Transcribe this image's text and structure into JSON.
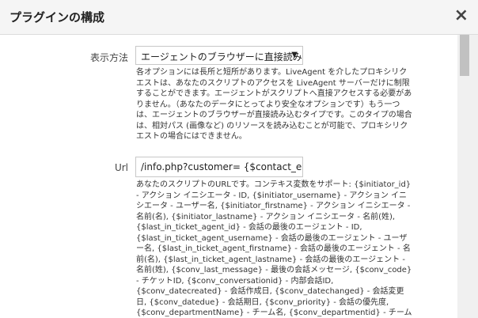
{
  "dialog": {
    "title": "プラグインの構成",
    "close_glyph": "×"
  },
  "fields": {
    "display_method": {
      "label": "表示方法",
      "selected": "エージェントのブラウザーに直接読み込む",
      "help": "各オプションには長所と短所があります。LiveAgent を介したプロキシリクエストは、あなたのスクリプトのアクセスを LiveAgent サーバーだけに制限することができます。エージェントがスクリプトへ直接アクセスする必要がありません。（あなたのデータにとってより安全なオプションです）もう一つは、エージェントのブラウザーが直接読み込むタイプです。このタイプの場合は、相対パス (画像など) のリソースを読み込むことが可能で、プロキシリクエストの場合にはできません。"
    },
    "url": {
      "label": "Url",
      "value": "/info.php?customer= {$contact_email}",
      "help": "あなたのスクリプトのURLです。コンテキス変数をサポート: {$initiator_id} - アクション イニシエータ - ID, {$initiator_username} - アクション イニシエータ - ユーザー名, {$initiator_firstname} - アクション イニシエータ - 名前(名), {$initiator_lastname} - アクション イニシエータ - 名前(姓), {$last_in_ticket_agent_id} - 会話の最後のエージェント - ID, {$last_in_ticket_agent_username} - 会話の最後のエージェント - ユーザー名, {$last_in_ticket_agent_firstname} - 会話の最後のエージェント - 名前(名), {$last_in_ticket_agent_lastname} - 会話の最後のエージェント - 名前(姓), {$conv_last_message} - 最後の会話メッセージ, {$conv_code} - チケットID, {$conv_conversationid} - 内部会話ID, {$conv_datecreated} - 会話作成日, {$conv_datechanged} - 会話変更日, {$conv_datedue} - 会話期日, {$conv_priority} - 会話の優先度, {$conv_departmentName} - チーム名, {$conv_departmentid} - チームID, {$conv_agentid} - 割り当てられたチケット -"
    }
  }
}
